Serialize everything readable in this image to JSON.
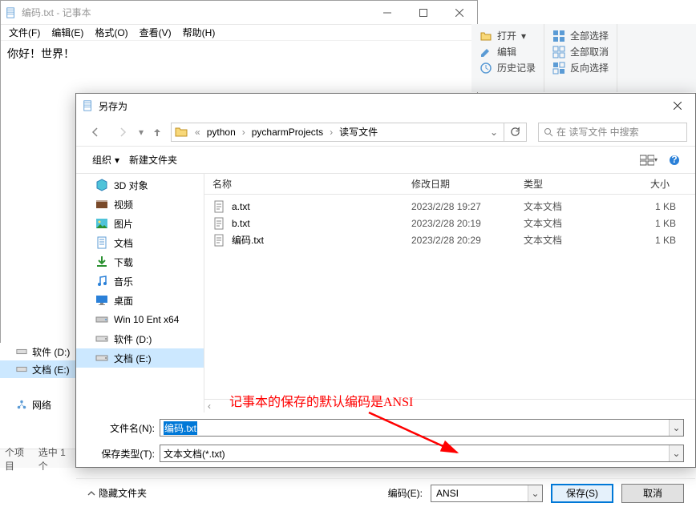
{
  "notepad": {
    "title": "编码.txt - 记事本",
    "menu": {
      "file": "文件(F)",
      "edit": "编辑(E)",
      "format": "格式(O)",
      "view": "查看(V)",
      "help": "帮助(H)"
    },
    "content": "你好！世界！"
  },
  "ribbon": {
    "open": "打开",
    "edit": "编辑",
    "history": "历史记录",
    "select_all": "全部选择",
    "deselect": "全部取消",
    "invert": "反向选择"
  },
  "dialog": {
    "title": "另存为",
    "breadcrumb": [
      "python",
      "pycharmProjects",
      "读写文件"
    ],
    "search_placeholder": "在 读写文件 中搜索",
    "organize": "组织",
    "new_folder": "新建文件夹",
    "columns": {
      "name": "名称",
      "date": "修改日期",
      "type": "类型",
      "size": "大小"
    },
    "sidebar_items": [
      {
        "label": "3D 对象",
        "icon": "3d"
      },
      {
        "label": "视频",
        "icon": "video"
      },
      {
        "label": "图片",
        "icon": "picture"
      },
      {
        "label": "文档",
        "icon": "document"
      },
      {
        "label": "下载",
        "icon": "download"
      },
      {
        "label": "音乐",
        "icon": "music"
      },
      {
        "label": "桌面",
        "icon": "desktop"
      },
      {
        "label": "Win 10 Ent x64",
        "icon": "disk"
      },
      {
        "label": "软件 (D:)",
        "icon": "drive"
      },
      {
        "label": "文档 (E:)",
        "icon": "drive",
        "selected": true
      }
    ],
    "files": [
      {
        "name": "a.txt",
        "date": "2023/2/28 19:27",
        "type": "文本文档",
        "size": "1 KB"
      },
      {
        "name": "b.txt",
        "date": "2023/2/28 20:19",
        "type": "文本文档",
        "size": "1 KB"
      },
      {
        "name": "编码.txt",
        "date": "2023/2/28 20:29",
        "type": "文本文档",
        "size": "1 KB"
      }
    ],
    "filename_label": "文件名(N):",
    "filename_value": "编码.txt",
    "filetype_label": "保存类型(T):",
    "filetype_value": "文本文档(*.txt)",
    "hide_folders": "隐藏文件夹",
    "encoding_label": "编码(E):",
    "encoding_value": "ANSI",
    "save_btn": "保存(S)",
    "cancel_btn": "取消"
  },
  "explorer_tree": {
    "items": [
      "软件 (D:)",
      "文档 (E:)",
      "",
      "网络"
    ],
    "selected_index": 1,
    "footer_count": "个项目",
    "footer_sel": "选中 1 个"
  },
  "annotation": "记事本的保存的默认编码是ANSI"
}
